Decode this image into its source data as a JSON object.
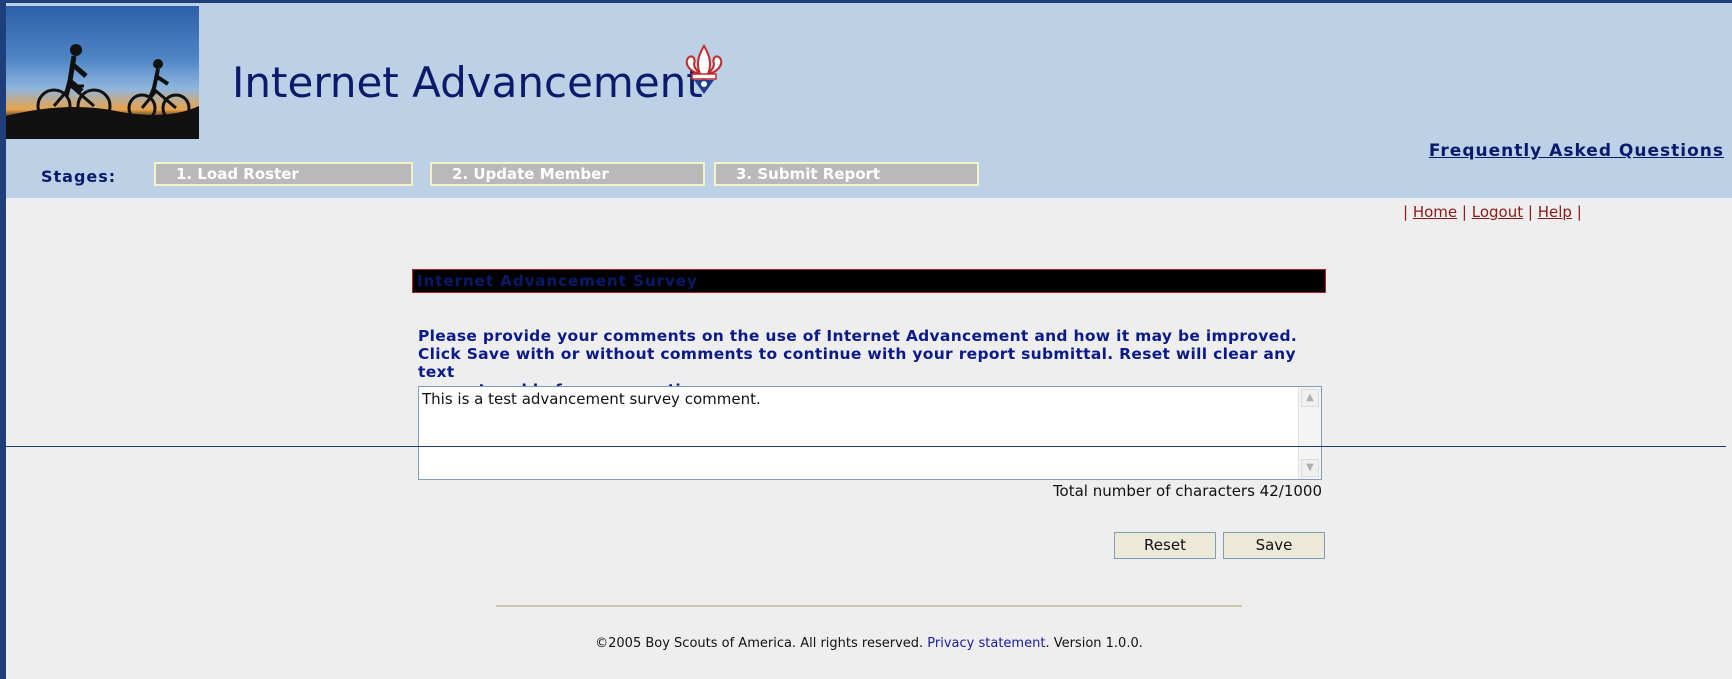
{
  "header": {
    "app_title": "Internet Advancement",
    "faq_link": "Frequently Asked Questions",
    "stages_label": "Stages:",
    "stages": [
      {
        "label": "1. Load Roster"
      },
      {
        "label": "2. Update Member"
      },
      {
        "label": "3. Submit Report"
      }
    ]
  },
  "nav_links": {
    "home": "Home",
    "logout": "Logout",
    "help": "Help",
    "separator": "|"
  },
  "survey": {
    "title": "Internet Advancement Survey",
    "instructions_line1": "Please provide your comments on the use of Internet Advancement and how it may be improved.",
    "instructions_line2": "Click Save with or without comments to continue with your report submittal. Reset will clear any text",
    "instructions_line3": "you entered before you continue.",
    "comment_value": "This is a test advancement survey comment.",
    "char_count": "Total number of characters 42/1000",
    "reset_label": "Reset",
    "save_label": "Save"
  },
  "footer": {
    "copyright": "©2005 Boy Scouts of America. All rights reserved.",
    "privacy_link": "Privacy statement",
    "version": ". Version 1.0.0."
  },
  "colors": {
    "header_bg": "#bdd1e6",
    "title_navy": "#0b1a6b",
    "link_red": "#8b1a1a",
    "stage_bg": "#b9b9b9"
  },
  "icons": {
    "logo": "bicycle-riders-sunset-image",
    "emblem": "fleur-de-lis-icon"
  }
}
